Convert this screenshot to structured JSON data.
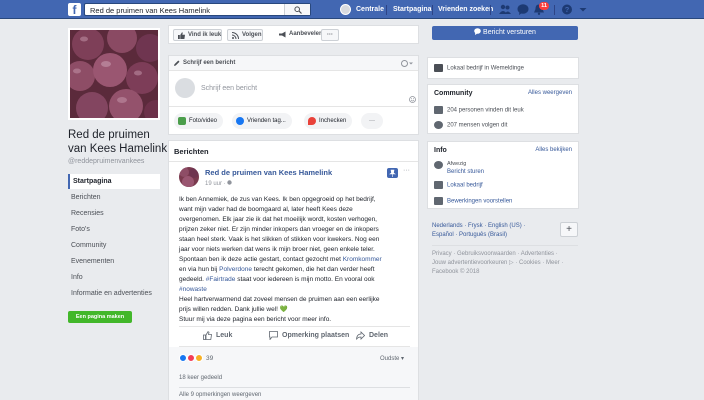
{
  "topbar": {
    "logo": "f",
    "search_value": "Red de pruimen van Kees Hamelink",
    "profile_name": "Centrale",
    "home": "Startpagina",
    "find_friends": "Vrienden zoeken",
    "notification_count": "11",
    "brand_color": "#4267b2"
  },
  "left": {
    "page_name_line1": "Red de pruimen",
    "page_name_line2": "van Kees Hamelink",
    "handle": "@reddepruimenvankees",
    "nav": [
      "Startpagina",
      "Berichten",
      "Recensies",
      "Foto's",
      "Community",
      "Evenementen",
      "Info",
      "Informatie en advertenties"
    ],
    "create_page": "Een pagina maken"
  },
  "actions": {
    "liked": "Vind ik leuk",
    "follow": "Volgen",
    "recommend": "Aanbevelen",
    "more": "···",
    "send_message": "Bericht versturen"
  },
  "composer": {
    "tab": "Schrijf een bericht",
    "placeholder": "Schrijf een bericht",
    "buttons": [
      "Foto/video",
      "Vrienden tag...",
      "Inchecken",
      "···"
    ]
  },
  "posts": {
    "heading": "Berichten",
    "author": "Red de pruimen van Kees Hamelink",
    "time": "19 uur",
    "menu": "···",
    "lines": [
      "Ik ben Annemiek, de zus van Kees. Ik ben opgegroeid op het bedrijf,",
      "want mijn vader had de boomgaard al, later heeft Kees deze",
      "overgenomen. Elk jaar zie ik dat het moeilijk wordt, kosten verhogen,",
      "prijzen zeker niet. Er zijn minder inkopers dan vroeger en de inkopers",
      "staan heel sterk. Vaak is het slikken of stikken voor kwekers. Nog een",
      "jaar voor niets werken dat wens ik mijn broer niet, geen enkele teler.",
      "Spontaan ben ik deze actie gestart, contact gezocht met",
      "en via hun bij",
      "terecht gekomen, die het dan verder heeft",
      "gedeeld.",
      "staat voor iedereen is mijn motto. En vooral ook",
      "Heel hartverwarmend dat zoveel mensen de pruimen aan een eerlijke",
      "prijs willen redden. Dank jullie wel!",
      "Stuur mij via deze pagina een bericht voor meer info."
    ],
    "link_kromkommer": "Kromkommer",
    "link_polverdone": "Polverdone",
    "hashtag_fairtrade": "#Fairtrade",
    "hashtag_nowaste": "#nowaste",
    "heart_emoji": "💚",
    "like": "Leuk",
    "comment": "Opmerking plaatsen",
    "share": "Delen",
    "reactions": "39",
    "order": "Oudste",
    "shares_count": "18 keer gedeeld",
    "view_comments": "Alle 9 opmerkingen weergeven"
  },
  "right": {
    "local": "Lokaal bedrijf in Wemeldinge",
    "community_title": "Community",
    "community_link": "Alles weergeven",
    "likes_text": "204 personen vinden dit leuk",
    "follows_text": "207 mensen volgen dit",
    "info_title": "Info",
    "info_link": "Alles bekijken",
    "reply_label": "Afwezig",
    "message_link": "Bericht sturen",
    "category": "Lokaal bedrijf",
    "suggest": "Bewerkingen voorstellen"
  },
  "languages": {
    "line1": "Nederlands · Frysk · English (US) ·",
    "line2": "Español · Português (Brasil)",
    "plus": "+"
  },
  "footer": {
    "line1": "Privacy · Gebruiksvoorwaarden · Advertenties ·",
    "line2": "Jouw advertentievoorkeuren ▷ · Cookies · Meer ·",
    "line3": "Facebook © 2018"
  }
}
